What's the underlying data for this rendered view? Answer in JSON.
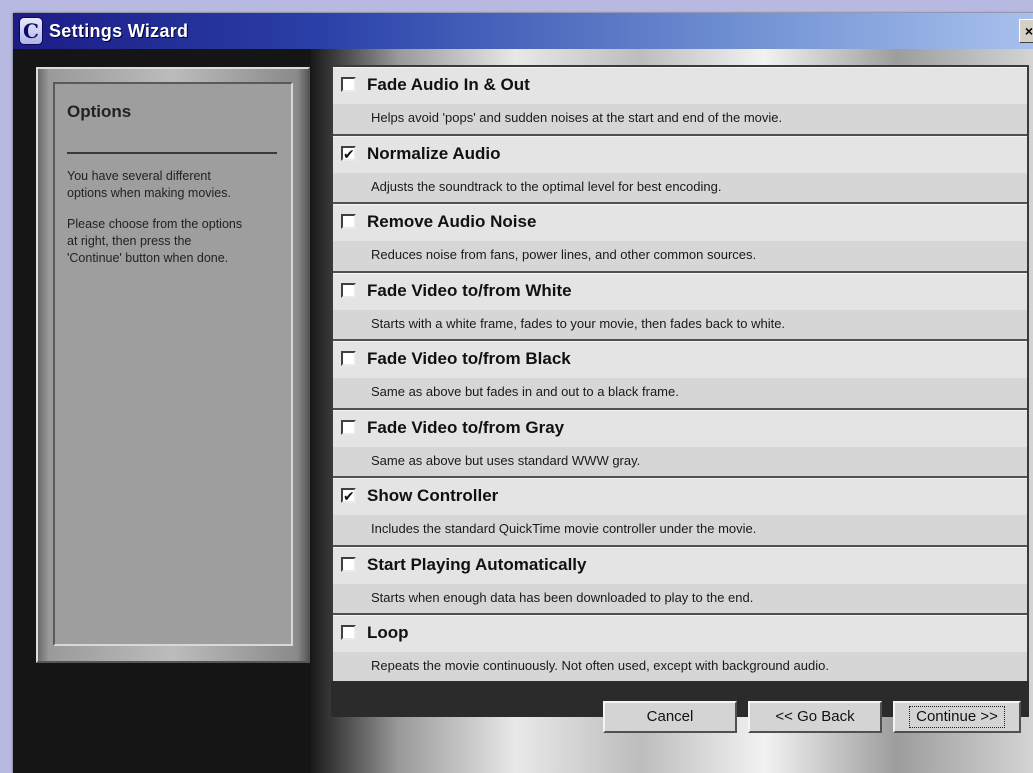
{
  "window": {
    "title": "Settings Wizard",
    "app_icon_glyph": "C",
    "close_glyph": "×"
  },
  "sidebar": {
    "title": "Options",
    "paragraph_1": "You have several different\noptions when making movies.",
    "paragraph_2": "Please choose from the options\nat right, then press the\n'Continue' button when done."
  },
  "options": [
    {
      "label": "Fade Audio In & Out",
      "description": "Helps avoid 'pops' and sudden noises at the start and end of the movie.",
      "checked": false
    },
    {
      "label": "Normalize Audio",
      "description": "Adjusts the soundtrack to the optimal level for best encoding.",
      "checked": true
    },
    {
      "label": "Remove Audio Noise",
      "description": "Reduces noise from fans, power lines, and other common sources.",
      "checked": false
    },
    {
      "label": "Fade Video to/from White",
      "description": "Starts with a white frame, fades to your movie, then fades back to white.",
      "checked": false
    },
    {
      "label": "Fade Video to/from Black",
      "description": "Same as above but fades in and out to a black frame.",
      "checked": false
    },
    {
      "label": "Fade Video to/from Gray",
      "description": "Same as above but uses standard WWW gray.",
      "checked": false
    },
    {
      "label": "Show Controller",
      "description": "Includes the standard QuickTime movie controller under the movie.",
      "checked": true
    },
    {
      "label": "Start Playing Automatically",
      "description": "Starts when enough data has been downloaded to play to the end.",
      "checked": false
    },
    {
      "label": "Loop",
      "description": "Repeats the movie continuously. Not often used, except with background audio.",
      "checked": false
    }
  ],
  "buttons": {
    "cancel": "Cancel",
    "back": "<< Go Back",
    "continue": "Continue >>"
  },
  "check_glyph": "✔",
  "colors": {
    "titlebar_start": "#1c1c86",
    "titlebar_end": "#a9c2ee",
    "desktop": "#b7b9e0"
  }
}
